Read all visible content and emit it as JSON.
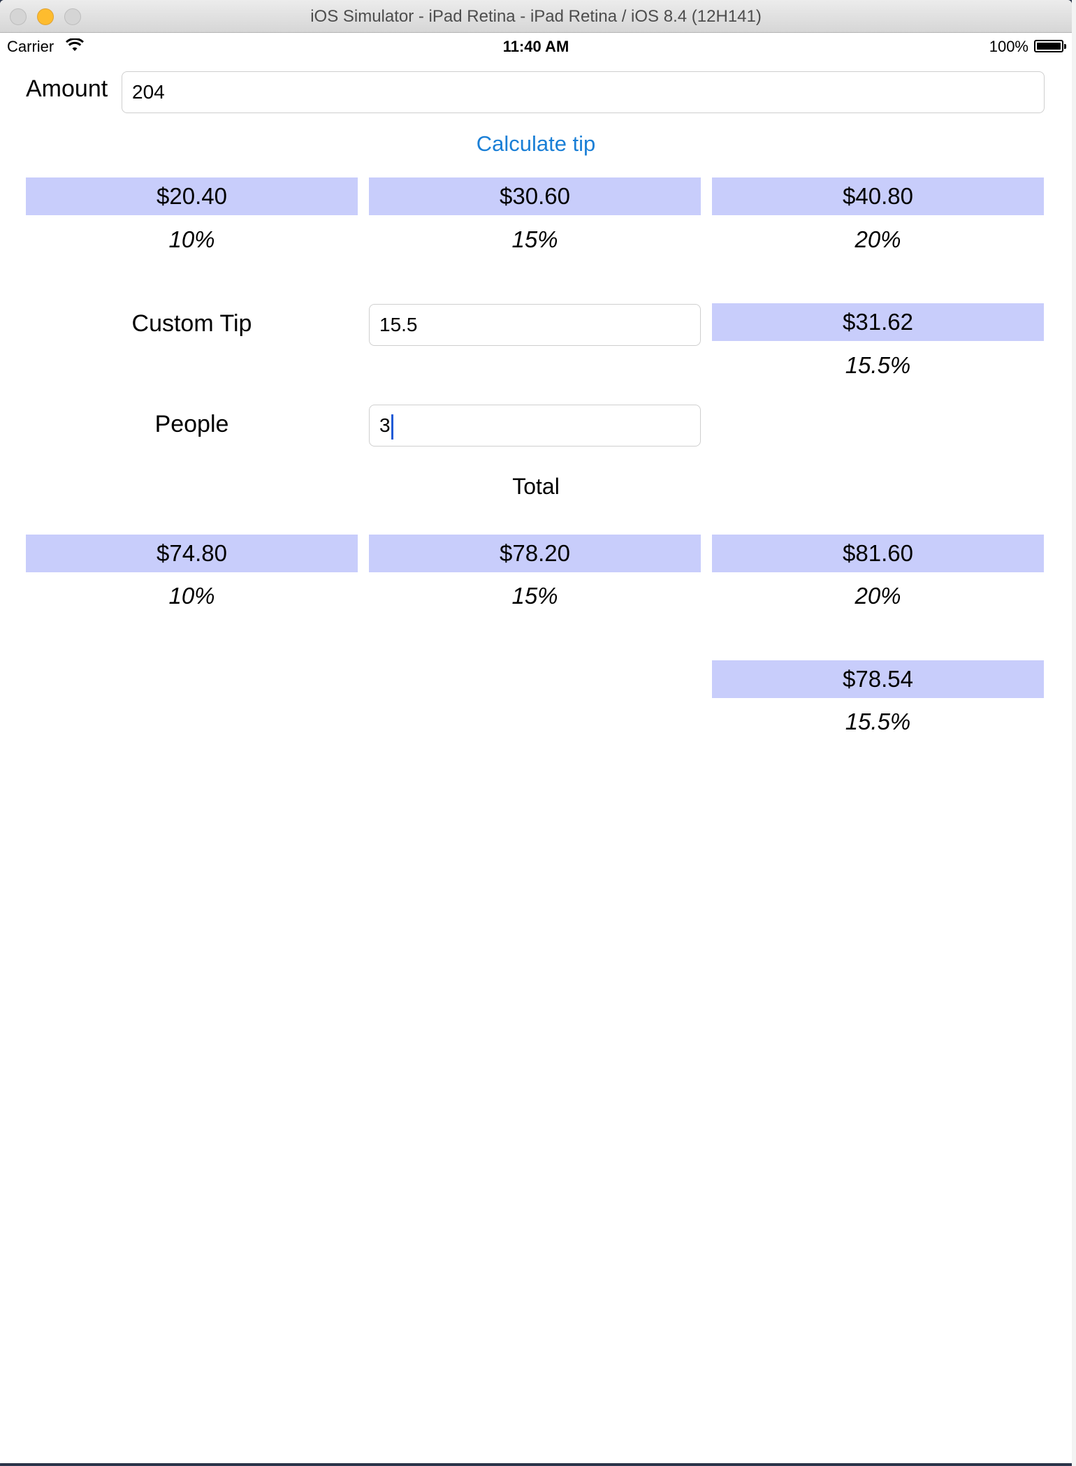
{
  "window": {
    "title": "iOS Simulator - iPad Retina - iPad Retina / iOS 8.4 (12H141)"
  },
  "status": {
    "carrier": "Carrier",
    "time": "11:40 AM",
    "battery": "100%",
    "battery_level": 1.0
  },
  "amount": {
    "label": "Amount",
    "value": "204"
  },
  "calculate_label": "Calculate tip",
  "tips": [
    {
      "value": "$20.40",
      "pct": "10%"
    },
    {
      "value": "$30.60",
      "pct": "15%"
    },
    {
      "value": "$40.80",
      "pct": "20%"
    }
  ],
  "custom_tip": {
    "label": "Custom Tip",
    "value": "15.5",
    "result": "$31.62",
    "pct": "15.5%"
  },
  "people": {
    "label": "People",
    "value": "3"
  },
  "total_label": "Total",
  "totals": [
    {
      "value": "$74.80",
      "pct": "10%"
    },
    {
      "value": "$78.20",
      "pct": "15%"
    },
    {
      "value": "$81.60",
      "pct": "20%"
    }
  ],
  "custom_total": {
    "value": "$78.54",
    "pct": "15.5%"
  },
  "colors": {
    "result_background": "#c8cdfb",
    "link": "#1a7fd6"
  }
}
